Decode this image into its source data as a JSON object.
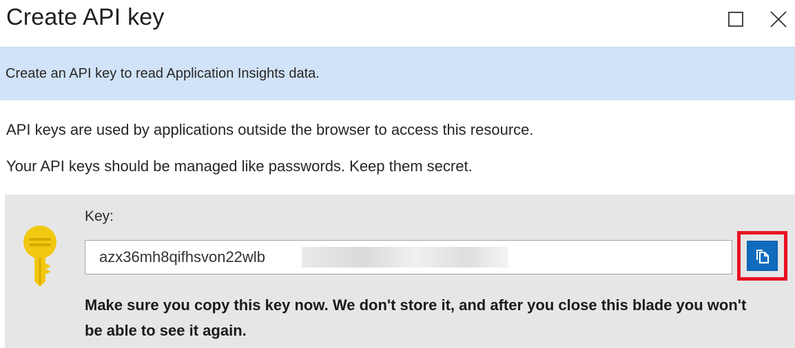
{
  "header": {
    "title": "Create API key",
    "maximize_icon": "maximize-icon",
    "close_icon": "close-icon"
  },
  "banner": {
    "text": "Create an API key to read Application Insights data."
  },
  "description": {
    "line1": "API keys are used by applications outside the browser to access this resource.",
    "line2": "Your API keys should be managed like passwords. Keep them secret."
  },
  "key_section": {
    "icon": "key-icon",
    "label": "Key:",
    "value": "azx36mh8qifhsvon22wlb",
    "copy_icon": "copy-icon",
    "warning": "Make sure you copy this key now. We don't store it, and after you close this blade you won't be able to see it again."
  },
  "colors": {
    "banner_bg": "#d1e3f8",
    "panel_bg": "#e6e6e6",
    "copy_button": "#0f6cbd",
    "highlight": "#e81123",
    "key_gold": "#f2c811"
  }
}
